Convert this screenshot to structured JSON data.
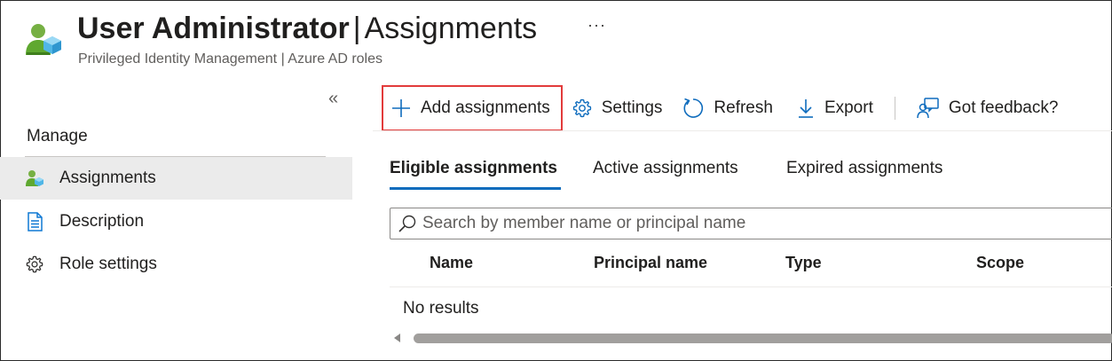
{
  "header": {
    "title_bold": "User Administrator",
    "title_separator": "|",
    "title_section": "Assignments",
    "more_label": "···",
    "subtitle": "Privileged Identity Management | Azure AD roles",
    "icon": "user-admin-icon"
  },
  "sidebar": {
    "collapse_label": "«",
    "section_label": "Manage",
    "items": [
      {
        "label": "Assignments",
        "icon": "user-assignment-icon",
        "selected": true
      },
      {
        "label": "Description",
        "icon": "document-icon",
        "selected": false
      },
      {
        "label": "Role settings",
        "icon": "gear-icon",
        "selected": false
      }
    ]
  },
  "toolbar": {
    "add_label": "Add assignments",
    "settings_label": "Settings",
    "refresh_label": "Refresh",
    "export_label": "Export",
    "feedback_label": "Got feedback?"
  },
  "tabs": [
    {
      "label": "Eligible assignments",
      "active": true
    },
    {
      "label": "Active assignments",
      "active": false
    },
    {
      "label": "Expired assignments",
      "active": false
    }
  ],
  "search": {
    "placeholder": "Search by member name or principal name",
    "value": ""
  },
  "table": {
    "columns": [
      "Name",
      "Principal name",
      "Type",
      "Scope"
    ],
    "empty_message": "No results"
  },
  "colors": {
    "accent": "#0f6cbd",
    "highlight_border": "#e23b3b",
    "selected_nav_bg": "#ebebeb",
    "user_icon_green": "#5fa830"
  }
}
